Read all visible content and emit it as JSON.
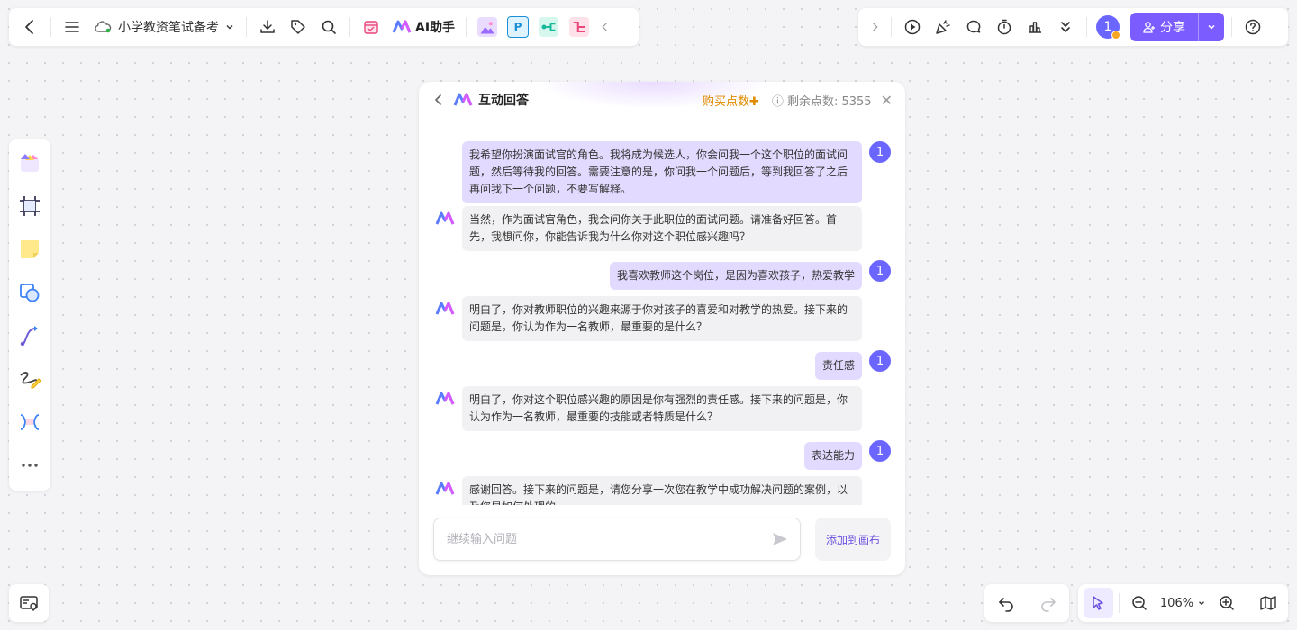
{
  "doc": {
    "title": "小学教资笔试备考"
  },
  "toolbar": {
    "ai_label": "AI助手",
    "p_icon_text": "P"
  },
  "topright": {
    "avatar": "1",
    "share_label": "分享"
  },
  "chat": {
    "title": "互动回答",
    "buy_points": "购买点数✚",
    "remaining": "剩余点数: 5355",
    "input_placeholder": "继续输入问题",
    "add_to_canvas": "添加到画布",
    "user_avatar": "1",
    "messages": [
      {
        "role": "user",
        "text": "我希望你扮演面试官的角色。我将成为候选人，你会问我一个这个职位的面试问题，然后等待我的回答。需要注意的是，你问我一个问题后，等到我回答了之后再问我下一个问题，不要写解释。"
      },
      {
        "role": "ai",
        "text": "当然，作为面试官角色，我会问你关于此职位的面试问题。请准备好回答。首先，我想问你，你能告诉我为什么你对这个职位感兴趣吗？"
      },
      {
        "role": "user",
        "text": "我喜欢教师这个岗位，是因为喜欢孩子，热爱教学"
      },
      {
        "role": "ai",
        "text": "明白了，你对教师职位的兴趣来源于你对孩子的喜爱和对教学的热爱。接下来的问题是，你认为作为一名教师，最重要的是什么？"
      },
      {
        "role": "user",
        "text": "责任感"
      },
      {
        "role": "ai",
        "text": "明白了，你对这个职位感兴趣的原因是你有强烈的责任感。接下来的问题是，你认为作为一名教师，最重要的技能或者特质是什么？"
      },
      {
        "role": "user",
        "text": "表达能力"
      },
      {
        "role": "ai",
        "text": "感谢回答。接下来的问题是，请您分享一次您在教学中成功解决问题的案例，以及您是如何处理的。"
      }
    ]
  },
  "zoom": {
    "level": "106%"
  },
  "colors": {
    "accent": "#7b5cff",
    "user_bubble": "#e3dbff",
    "ai_bubble": "#f1f1f3",
    "avatar": "#6b66ff",
    "buy": "#e08a00"
  }
}
